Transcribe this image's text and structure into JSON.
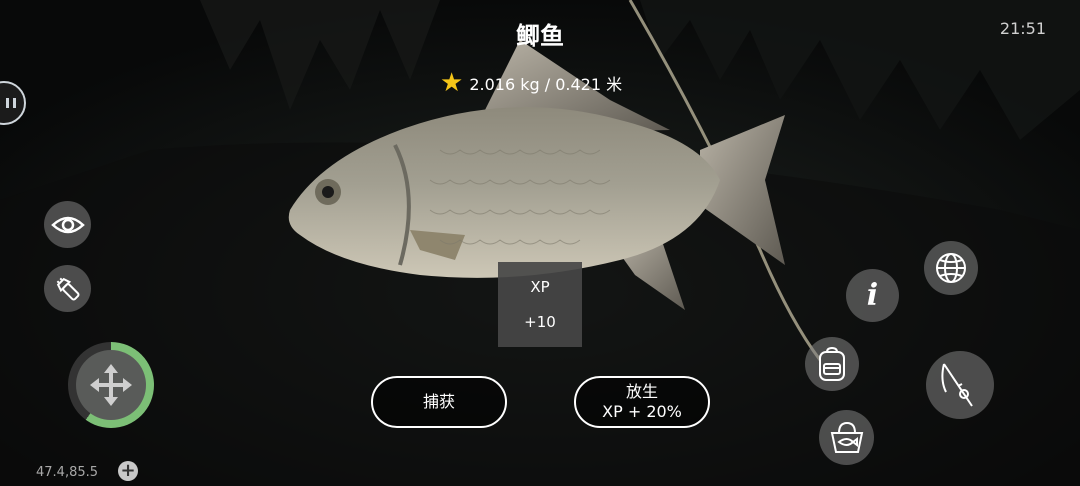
{
  "header": {
    "fish_name": "鲫鱼",
    "weight_length": "2.016 kg / 0.421 米",
    "star_icon": "star-icon",
    "clock": "21:51"
  },
  "xp_popup": {
    "label": "XP",
    "value": "+10"
  },
  "actions": {
    "catch_label": "捕获",
    "release_label": "放生",
    "release_bonus": "XP + 20%"
  },
  "hud": {
    "coordinates": "47.4,85.5",
    "left_buttons": [
      "eye-icon",
      "flashlight-icon"
    ],
    "right_buttons": [
      "globe-icon",
      "info-icon",
      "backpack-icon",
      "fishing-rod-icon",
      "keepnet-basket-icon"
    ],
    "joystick_icon": "move-arrows-icon",
    "joystick_ring_fraction": 0.6,
    "ring_color": "#7cbf76",
    "star_color": "#f5c518"
  }
}
